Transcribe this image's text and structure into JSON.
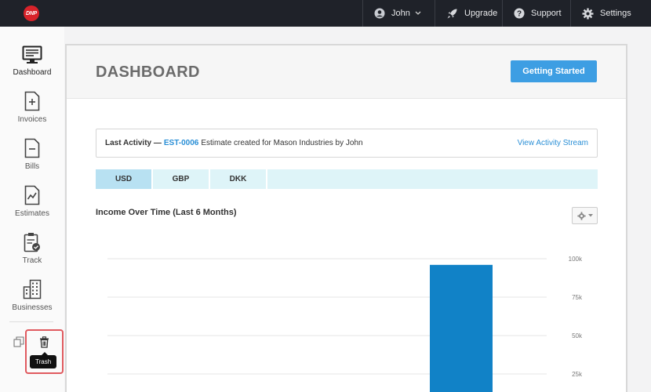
{
  "topbar": {
    "logo_text": "DNP",
    "user_label": "John",
    "upgrade_label": "Upgrade",
    "support_label": "Support",
    "settings_label": "Settings"
  },
  "sidebar": {
    "items": [
      {
        "label": "Dashboard",
        "icon": "monitor-icon"
      },
      {
        "label": "Invoices",
        "icon": "invoice-icon"
      },
      {
        "label": "Bills",
        "icon": "bill-icon"
      },
      {
        "label": "Estimates",
        "icon": "estimate-icon"
      },
      {
        "label": "Track",
        "icon": "clipboard-check-icon"
      },
      {
        "label": "Businesses",
        "icon": "buildings-icon"
      }
    ],
    "trash_tooltip": "Trash"
  },
  "main": {
    "title": "DASHBOARD",
    "getting_started": "Getting Started",
    "activity": {
      "prefix": "Last Activity —",
      "link": "EST-0006",
      "text": "Estimate created for Mason Industries by John",
      "view_link": "View Activity Stream"
    },
    "currency_tabs": [
      "USD",
      "GBP",
      "DKK"
    ],
    "active_currency": "USD",
    "chart_title": "Income Over Time (Last 6 Months)"
  },
  "chart_data": {
    "type": "bar",
    "title": "Income Over Time (Last 6 Months)",
    "y_ticks": [
      "100k",
      "75k",
      "50k",
      "25k"
    ],
    "ylim": [
      0,
      100000
    ],
    "values": [
      0,
      0,
      0,
      0,
      96000,
      0
    ],
    "bar_color": "#1182c7",
    "grid": true
  }
}
